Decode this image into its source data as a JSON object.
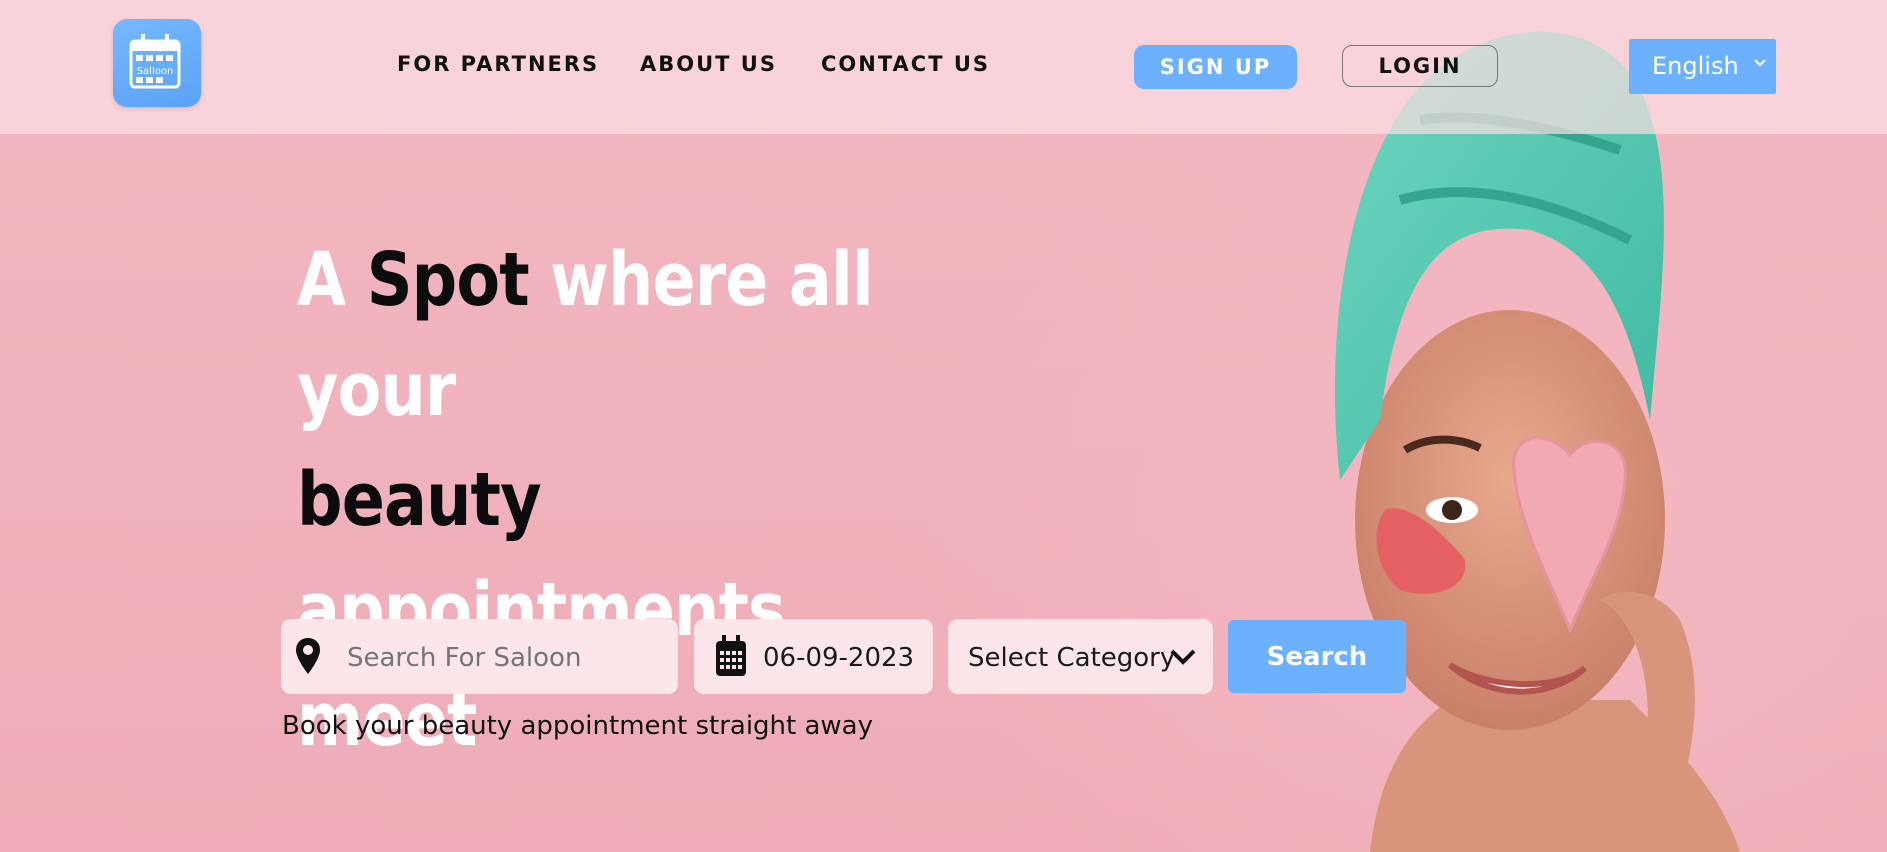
{
  "logo": {
    "text": "Salloon"
  },
  "nav": {
    "links": [
      "FOR PARTNERS",
      "ABOUT US",
      "CONTACT US"
    ],
    "signup_label": "SIGN UP",
    "login_label": "LOGIN",
    "language": "English"
  },
  "hero": {
    "headline": {
      "line1_a": "A",
      "line1_b": "Spot",
      "line1_c": "where all your",
      "line2_a": "beauty",
      "line2_b": "appointments",
      "line3": "meet"
    },
    "search": {
      "saloon_placeholder": "Search For Saloon",
      "date_value": "06-09-2023",
      "category_value": "Select Category",
      "button_label": "Search"
    },
    "tagline": "Book your beauty appointment straight away"
  },
  "colors": {
    "accent": "#6cb1ff",
    "background": "#f0b2bd",
    "field_bg": "#fde6e9"
  },
  "icons": [
    "calendar-logo-icon",
    "location-pin-icon",
    "calendar-icon",
    "chevron-down-icon"
  ]
}
